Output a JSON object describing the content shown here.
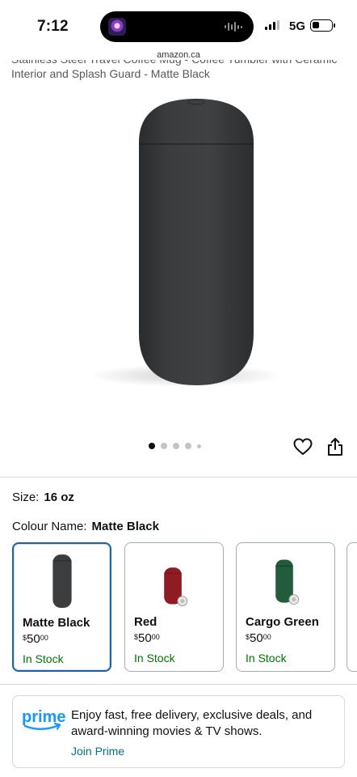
{
  "status_bar": {
    "time": "7:12",
    "network": "5G",
    "icons": [
      "now-playing-artwork",
      "audio-waveform-icon",
      "signal-icon",
      "battery-icon"
    ]
  },
  "browser": {
    "url": "amazon.ca"
  },
  "product": {
    "title_partial": "Stainless Steel Travel Coffee Mug - Coffee Tumbler with Ceramic Interior and Splash Guard - Matte Black",
    "image": {
      "subject": "matte black tumbler",
      "carousel_count": 5,
      "carousel_active": 1
    },
    "actions": [
      "heart-icon",
      "share-icon"
    ]
  },
  "size": {
    "label": "Size:",
    "value": "16 oz"
  },
  "colour": {
    "label": "Colour Name:",
    "value": "Matte Black",
    "options": [
      {
        "name": "Matte Black",
        "price_symbol": "$",
        "price_whole": "50",
        "price_fraction": "00",
        "stock": "In Stock",
        "color": "#3b3d3f",
        "selected": true
      },
      {
        "name": "Red",
        "price_symbol": "$",
        "price_whole": "50",
        "price_fraction": "00",
        "stock": "In Stock",
        "color": "#8f1c24",
        "selected": false
      },
      {
        "name": "Cargo Green",
        "price_symbol": "$",
        "price_whole": "50",
        "price_fraction": "00",
        "stock": "In Stock",
        "color": "#235c3c",
        "selected": false
      }
    ]
  },
  "prime": {
    "logo_text": "prime",
    "message": "Enjoy fast, free delivery, exclusive deals, and award-winning movies & TV shows.",
    "cta": "Join Prime"
  },
  "colors": {
    "link": "#007185",
    "in_stock": "#007600",
    "selected_border": "#2162a1",
    "prime_blue": "#1399ff"
  }
}
